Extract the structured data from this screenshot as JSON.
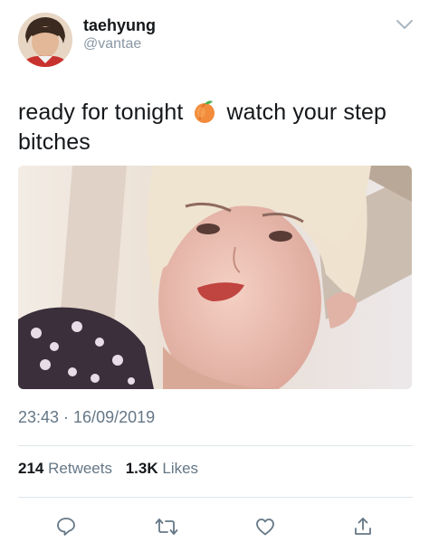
{
  "user": {
    "display_name": "taehyung",
    "handle": "@vantae"
  },
  "tweet": {
    "text_before_emoji": "ready for tonight",
    "emoji": "peach-emoji",
    "text_after_emoji": "watch your step",
    "text_line2": "bitches",
    "timestamp": "23:43 · 16/09/2019"
  },
  "stats": {
    "retweets_count": "214",
    "retweets_label": "Retweets",
    "likes_count": "1.3K",
    "likes_label": "Likes"
  },
  "actions": {
    "icons": [
      "reply-icon",
      "retweet-icon",
      "like-icon",
      "share-icon"
    ]
  },
  "colors": {
    "text": "#14171a",
    "secondary": "#657786",
    "divider": "#dfe5ea"
  }
}
